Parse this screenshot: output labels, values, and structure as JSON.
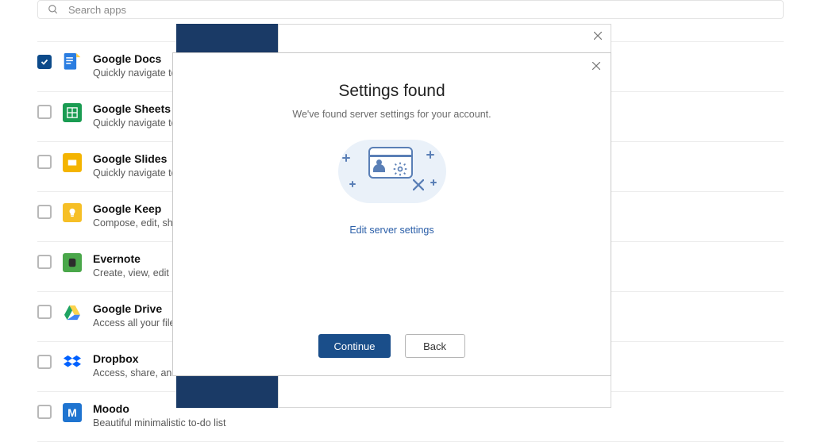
{
  "search": {
    "placeholder": "Search apps"
  },
  "apps": [
    {
      "name": "Google Docs",
      "desc": "Quickly navigate to your documents",
      "checked": true
    },
    {
      "name": "Google Sheets",
      "desc": "Quickly navigate to your spreadsheets",
      "checked": false
    },
    {
      "name": "Google Slides",
      "desc": "Quickly navigate to your presentations",
      "checked": false
    },
    {
      "name": "Google Keep",
      "desc": "Compose, edit, share, and collaborate on notes",
      "checked": false
    },
    {
      "name": "Evernote",
      "desc": "Create, view, edit notes and notebooks",
      "checked": false
    },
    {
      "name": "Google Drive",
      "desc": "Access all your files in one place",
      "checked": false
    },
    {
      "name": "Dropbox",
      "desc": "Access, share, and organize your files",
      "checked": false
    },
    {
      "name": "Moodo",
      "desc": "Beautiful minimalistic to-do list",
      "checked": false
    }
  ],
  "modal": {
    "title": "Settings found",
    "subtitle": "We've found server settings for your account.",
    "edit_link": "Edit server settings",
    "continue_label": "Continue",
    "back_label": "Back"
  },
  "icons": {
    "docs": {
      "bg": "#2a7de1",
      "accent": "#ffd04b"
    },
    "sheets": {
      "bg": "#1a9c52"
    },
    "slides": {
      "bg": "#f4b400"
    },
    "keep": {
      "bg": "#f6bf26"
    },
    "evernote": {
      "bg": "#4aa74a"
    },
    "drive": {
      "c1": "#1fa463",
      "c2": "#fcd34d",
      "c3": "#4285f4"
    },
    "dropbox": {
      "bg": "#0061ff"
    },
    "moodo": {
      "bg": "#1f74d0"
    }
  }
}
